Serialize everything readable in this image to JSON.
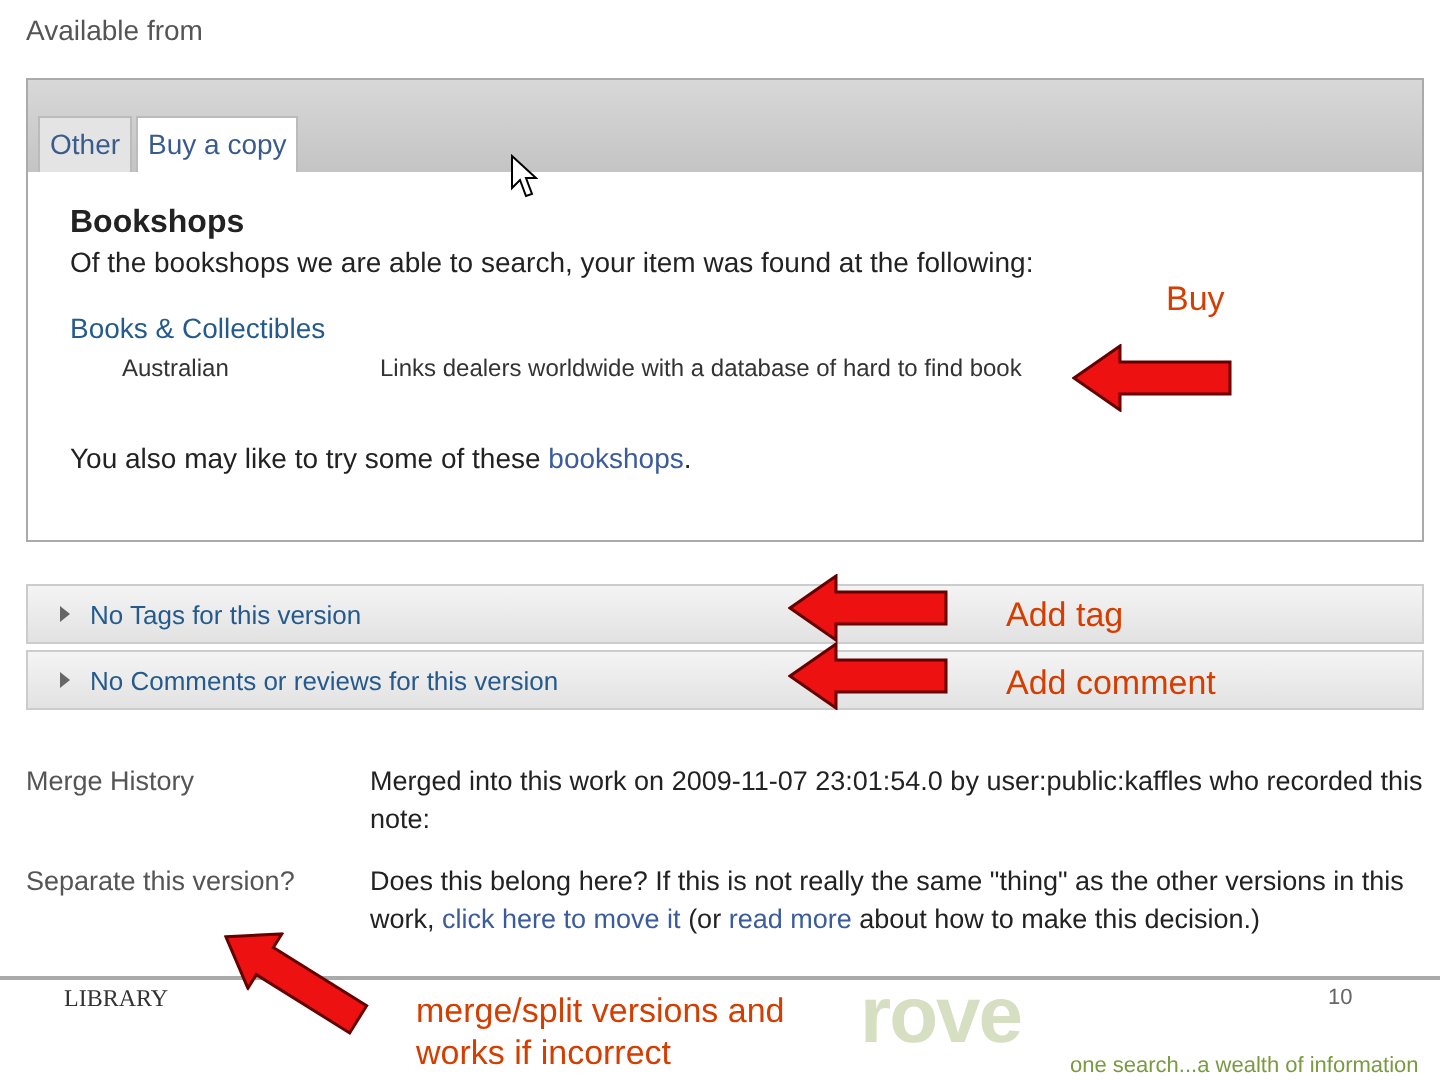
{
  "heading": "Available from",
  "tabs": [
    {
      "label": "Other",
      "selected": false
    },
    {
      "label": "Buy a copy",
      "selected": true
    }
  ],
  "bookshops": {
    "title": "Bookshops",
    "intro": "Of the bookshops we are able to search, your item was found at the following:",
    "shops": [
      {
        "name": "Books & Collectibles",
        "region": "Australian",
        "description": "Links dealers worldwide with a database of hard to find book"
      }
    ],
    "also_text": "You also may like to try some of these",
    "also_link": "bookshops",
    "also_end": "."
  },
  "sections": [
    {
      "label": "No Tags for this version",
      "expanded": false
    },
    {
      "label": "No Comments or reviews for this version",
      "expanded": false
    }
  ],
  "details": [
    {
      "label": "Merge History",
      "parts": [
        {
          "text": "Merged into this work on 2009-11-07 23:01:54.0 by user:public:kaffles who recorded this note:",
          "link": false
        }
      ]
    },
    {
      "label": "Separate this version?",
      "parts": [
        {
          "text": "Does this belong here? If this is not really the same \"thing\" as the other versions in this work, ",
          "link": false
        },
        {
          "text": "click here to move it",
          "link": true
        },
        {
          "text": " (or ",
          "link": false
        },
        {
          "text": "read more",
          "link": true
        },
        {
          "text": " about how to make this decision.)",
          "link": false
        }
      ]
    }
  ],
  "annotations": [
    {
      "kind": "buy",
      "text": "Buy"
    },
    {
      "kind": "tag",
      "text": "Add tag"
    },
    {
      "kind": "comment",
      "text": "Add comment"
    },
    {
      "kind": "merge",
      "text": "merge/split versions and works if incorrect"
    }
  ],
  "footer": {
    "logo": "LIBRARY",
    "brand": "rove",
    "page": "10",
    "slogan": "one search...a wealth of information"
  }
}
